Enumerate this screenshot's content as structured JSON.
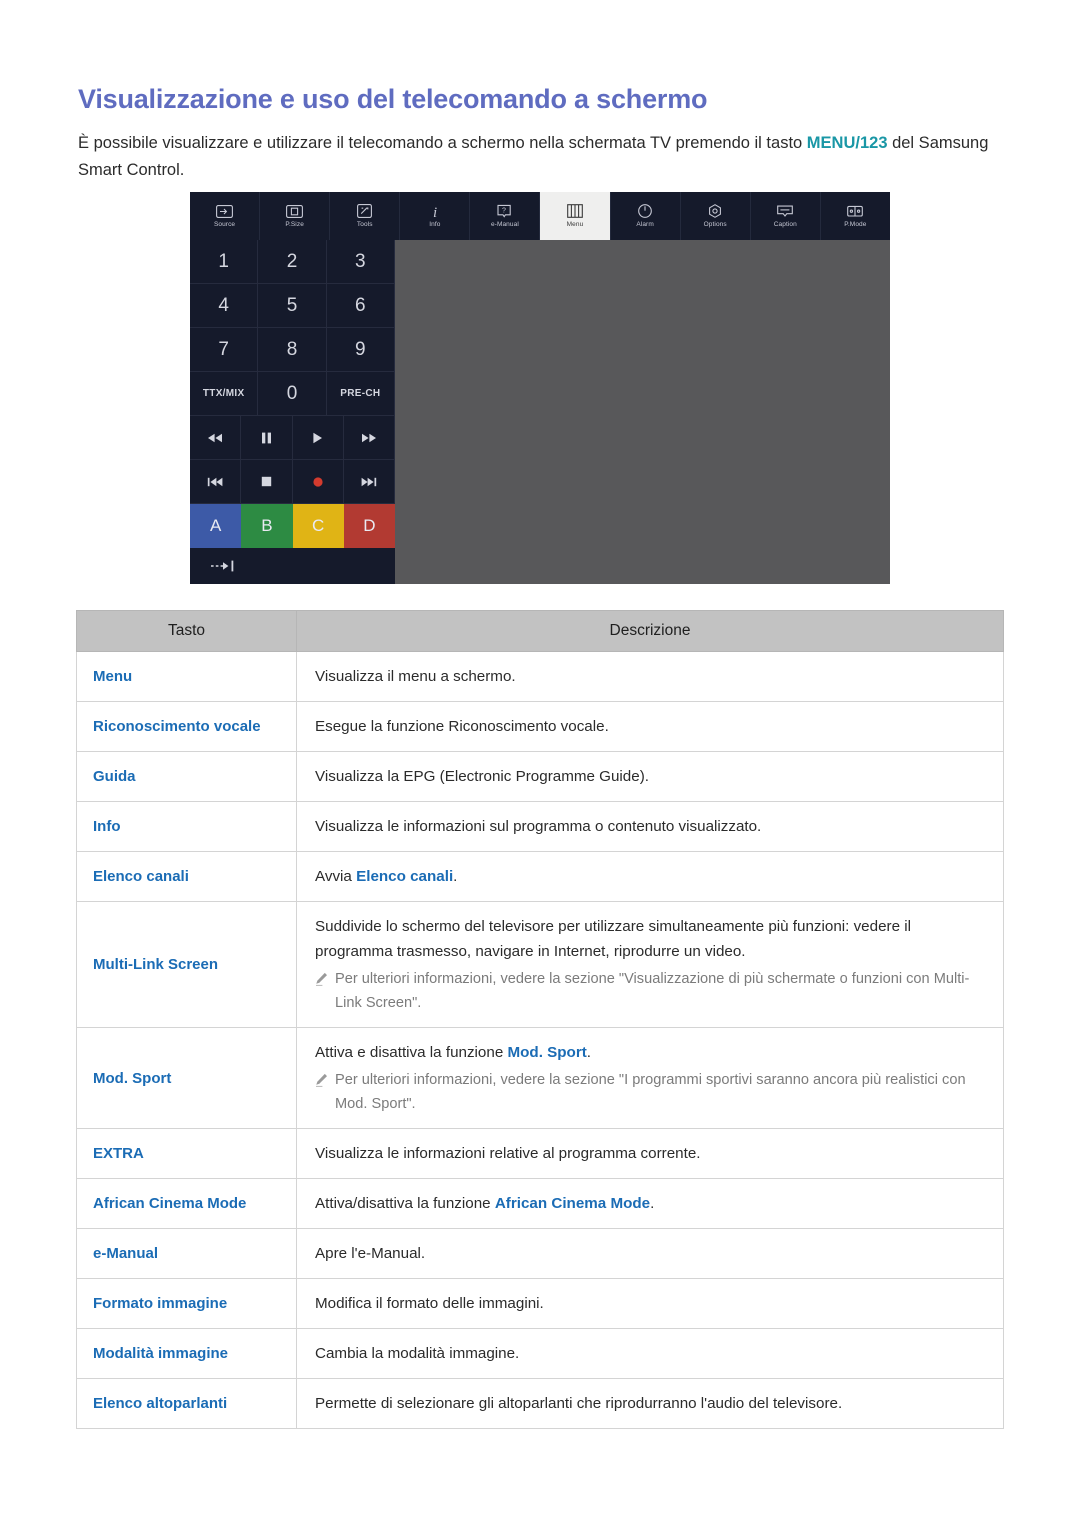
{
  "page": {
    "title": "Visualizzazione e uso del telecomando a schermo",
    "intro_part1": "È possibile visualizzare e utilizzare il telecomando a schermo nella schermata TV premendo il tasto ",
    "intro_highlight": "MENU/123",
    "intro_part2": " del Samsung Smart Control."
  },
  "colors": {
    "title_blue": "#5f6cc0",
    "link_blue": "#1b6cb5",
    "teal": "#1a97a6",
    "header_gray": "#c2c2c2",
    "remote_dark": "#151a2b",
    "remote_panel": "#58585a",
    "key_a": "#3d5aa7",
    "key_b": "#2d8b43",
    "key_c": "#e0b415",
    "key_d": "#b23a32",
    "record_red": "#d43b2e"
  },
  "remote": {
    "topbar": [
      {
        "label": "Source",
        "icon": "source-icon",
        "active": false
      },
      {
        "label": "P.Size",
        "icon": "psize-icon",
        "active": false
      },
      {
        "label": "Tools",
        "icon": "tools-icon",
        "active": false
      },
      {
        "label": "Info",
        "icon": "info-icon",
        "active": false
      },
      {
        "label": "e-Manual",
        "icon": "emanual-icon",
        "active": false
      },
      {
        "label": "Menu",
        "icon": "menu-icon",
        "active": true
      },
      {
        "label": "Alarm",
        "icon": "alarm-icon",
        "active": false
      },
      {
        "label": "Options",
        "icon": "options-icon",
        "active": false
      },
      {
        "label": "Caption",
        "icon": "caption-icon",
        "active": false
      },
      {
        "label": "P.Mode",
        "icon": "pmode-icon",
        "active": false
      }
    ],
    "keypad": [
      [
        "1",
        "2",
        "3"
      ],
      [
        "4",
        "5",
        "6"
      ],
      [
        "7",
        "8",
        "9"
      ],
      [
        "TTX/MIX",
        "0",
        "PRE-CH"
      ]
    ],
    "media_row_1": [
      "rewind-icon",
      "pause-icon",
      "play-icon",
      "fast-forward-icon"
    ],
    "media_row_2": [
      "skip-back-icon",
      "stop-icon",
      "record-icon",
      "skip-forward-icon"
    ],
    "color_keys": [
      "A",
      "B",
      "C",
      "D"
    ],
    "exit_icon": "exit-arrow-icon"
  },
  "table": {
    "headers": [
      "Tasto",
      "Descrizione"
    ],
    "rows": [
      {
        "key": "Menu",
        "desc": "Visualizza il menu a schermo."
      },
      {
        "key": "Riconoscimento vocale",
        "desc": "Esegue la funzione Riconoscimento vocale."
      },
      {
        "key": "Guida",
        "desc": "Visualizza la EPG (Electronic Programme Guide)."
      },
      {
        "key": "Info",
        "desc": "Visualizza le informazioni sul programma o contenuto visualizzato."
      },
      {
        "key": "Elenco canali",
        "desc_pre": "Avvia ",
        "desc_link": "Elenco canali",
        "desc_post": "."
      },
      {
        "key": "Multi-Link Screen",
        "desc": "Suddivide lo schermo del televisore per utilizzare simultaneamente più funzioni: vedere il programma trasmesso, navigare in Internet, riprodurre un video.",
        "note": "Per ulteriori informazioni, vedere la sezione \"Visualizzazione di più schermate o funzioni con Multi-Link Screen\"."
      },
      {
        "key": "Mod. Sport",
        "desc_pre": "Attiva e disattiva la funzione ",
        "desc_link": "Mod. Sport",
        "desc_post": ".",
        "note": "Per ulteriori informazioni, vedere la sezione \"I programmi sportivi saranno ancora più realistici con Mod. Sport\"."
      },
      {
        "key": "EXTRA",
        "desc": "Visualizza le informazioni relative al programma corrente."
      },
      {
        "key": "African Cinema Mode",
        "desc_pre": "Attiva/disattiva la funzione ",
        "desc_link": "African Cinema Mode",
        "desc_post": "."
      },
      {
        "key": "e-Manual",
        "desc": "Apre l'e-Manual."
      },
      {
        "key": "Formato immagine",
        "desc": "Modifica il formato delle immagini."
      },
      {
        "key": "Modalità immagine",
        "desc": "Cambia la modalità immagine."
      },
      {
        "key": "Elenco altoparlanti",
        "desc": "Permette di selezionare gli altoparlanti che riprodurranno l'audio del televisore."
      }
    ]
  }
}
